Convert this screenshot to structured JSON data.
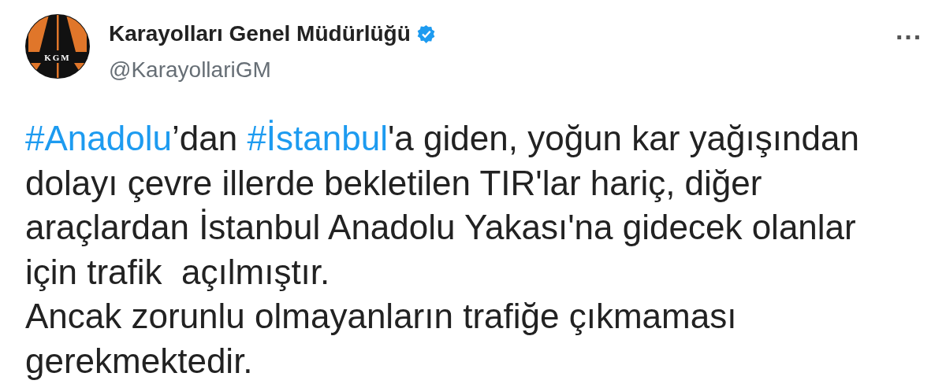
{
  "author": {
    "avatar_text": "KGM",
    "name": "Karayolları Genel Müdürlüğü",
    "verified": true,
    "handle": "@KarayollariGM"
  },
  "menu": "···",
  "body": [
    [
      {
        "kind": "hashtag",
        "text": "#Anadolu"
      },
      {
        "kind": "text",
        "text": "’dan "
      },
      {
        "kind": "hashtag",
        "text": "#İstanbul"
      },
      {
        "kind": "text",
        "text": "'a giden, yoğun kar yağışından dolayı çevre illerde bekletilen TIR'lar hariç, diğer araçlardan İstanbul Anadolu Yakası'na gidecek olanlar için trafik  açılmıştır."
      }
    ],
    [
      {
        "kind": "text",
        "text": "Ancak zorunlu olmayanların trafiğe çıkmaması gerekmektedir."
      }
    ]
  ]
}
